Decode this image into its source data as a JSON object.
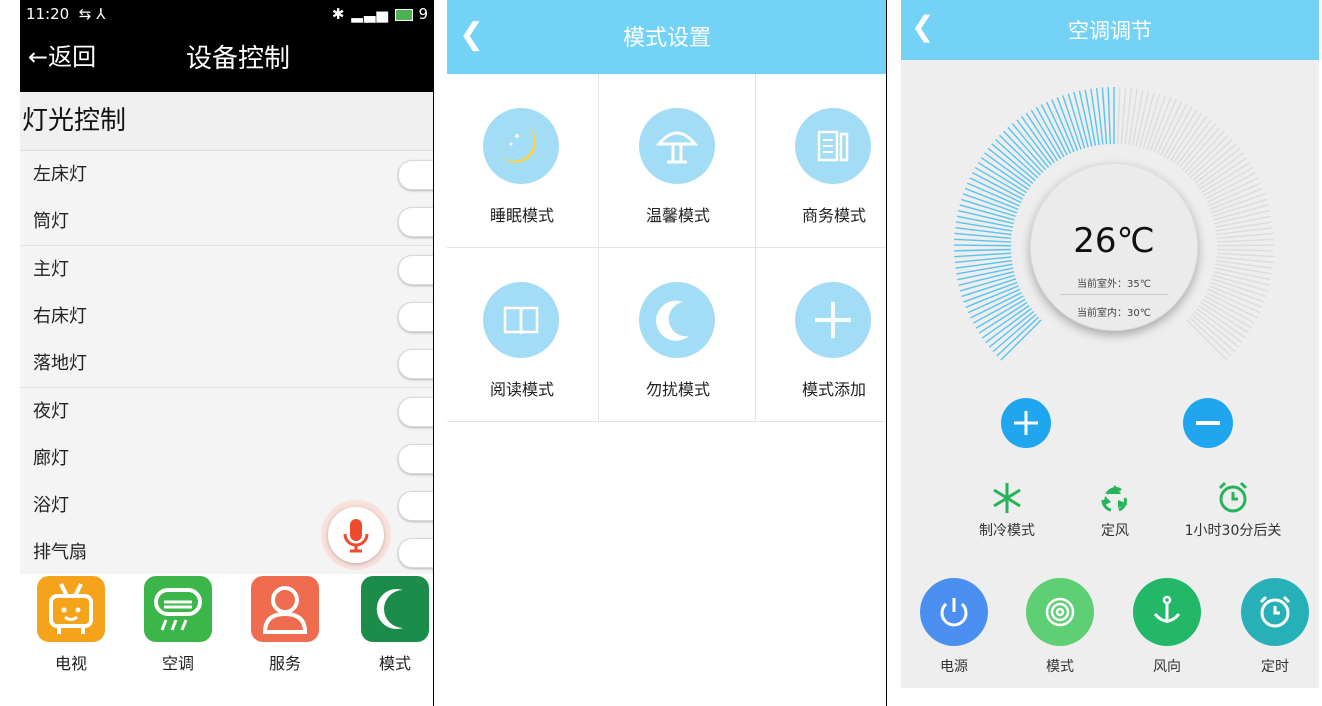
{
  "panel1": {
    "status": {
      "time": "11:20",
      "right": "9"
    },
    "header": {
      "back_label": "←返回",
      "title": "设备控制"
    },
    "section_title": "灯光控制",
    "lights": [
      {
        "label": "左床灯"
      },
      {
        "label": "筒灯"
      },
      {
        "label": "主灯"
      },
      {
        "label": "右床灯"
      },
      {
        "label": "落地灯"
      },
      {
        "label": "夜灯"
      },
      {
        "label": "廊灯"
      },
      {
        "label": "浴灯"
      },
      {
        "label": "排气扇"
      }
    ],
    "dock": [
      {
        "label": "电视",
        "color": "#f5a31a",
        "icon": "tv-icon"
      },
      {
        "label": "空调",
        "color": "#3cb54a",
        "icon": "air-conditioner-icon"
      },
      {
        "label": "服务",
        "color": "#ef6c4f",
        "icon": "person-icon"
      },
      {
        "label": "模式",
        "color": "#1b8c4a",
        "icon": "moon-icon"
      }
    ]
  },
  "panel2": {
    "header": {
      "title": "模式设置"
    },
    "modes": [
      {
        "label": "睡眠模式",
        "icon": "sleep-moon-icon"
      },
      {
        "label": "温馨模式",
        "icon": "lamp-icon"
      },
      {
        "label": "商务模式",
        "icon": "business-icon"
      },
      {
        "label": "阅读模式",
        "icon": "book-icon"
      },
      {
        "label": "勿扰模式",
        "icon": "crescent-icon"
      },
      {
        "label": "模式添加",
        "icon": "plus-icon"
      }
    ]
  },
  "panel3": {
    "header": {
      "title": "空调调节"
    },
    "temperature": "26℃",
    "outdoor": "当前室外：35℃",
    "indoor": "当前室内：30℃",
    "dial_fraction": 0.5,
    "modes": [
      {
        "label": "制冷模式",
        "icon": "snowflake-icon",
        "color": "#27b35a"
      },
      {
        "label": "定风",
        "icon": "recycle-icon",
        "color": "#27b35a"
      },
      {
        "label": "1小时30分后关",
        "icon": "alarm-clock-icon",
        "color": "#27b35a"
      }
    ],
    "bottom": [
      {
        "label": "电源",
        "color": "#4b8ff0",
        "icon": "power-icon"
      },
      {
        "label": "模式",
        "color": "#5fcf76",
        "icon": "target-icon"
      },
      {
        "label": "风向",
        "color": "#22b868",
        "icon": "anchor-icon"
      },
      {
        "label": "定时",
        "color": "#27b0b8",
        "icon": "alarm-clock-icon"
      }
    ]
  }
}
